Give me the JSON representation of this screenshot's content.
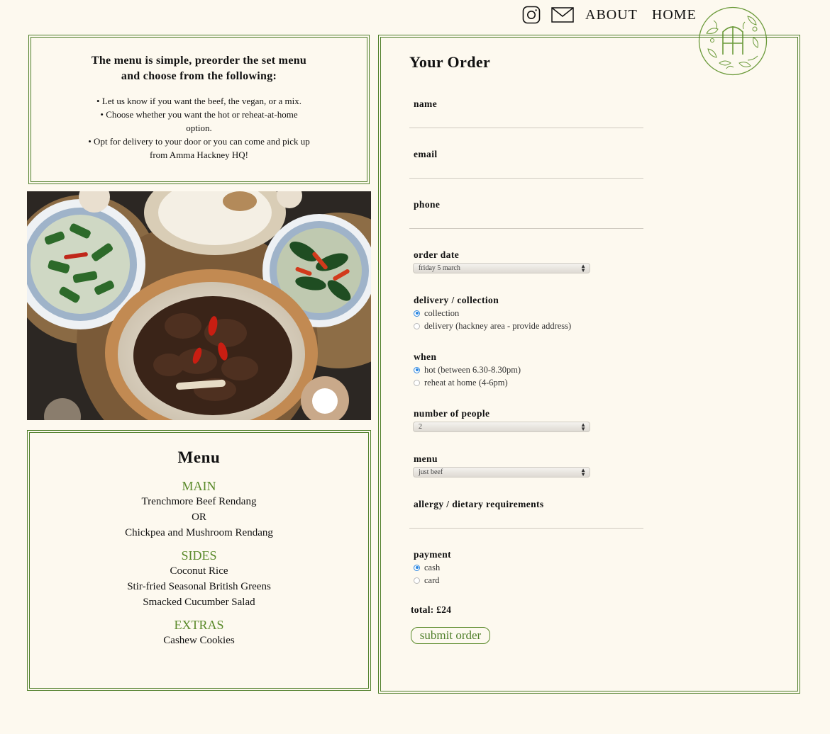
{
  "nav": {
    "about": "ABOUT",
    "home": "HOME",
    "icons": [
      "instagram-icon",
      "mail-icon"
    ]
  },
  "intro": {
    "heading_line1": "The menu is simple, preorder the set menu",
    "heading_line2": "and choose from the following:",
    "bullets": [
      "• Let us know if you want the beef, the vegan, or a mix.",
      "• Choose whether you want the hot or reheat-at-home",
      "option.",
      "• Opt for delivery to your door or you can come and pick up",
      "from Amma Hackney HQ!"
    ]
  },
  "menu": {
    "title": "Menu",
    "main_label": "MAIN",
    "main_items": [
      "Trenchmore Beef Rendang",
      "OR",
      "Chickpea and Mushroom Rendang"
    ],
    "sides_label": "SIDES",
    "sides_items": [
      "Coconut Rice",
      "Stir-fried Seasonal British Greens",
      "Smacked Cucumber Salad"
    ],
    "extras_label": "EXTRAS",
    "extras_items": [
      "Cashew Cookies"
    ]
  },
  "order": {
    "title": "Your Order",
    "name_label": "name",
    "email_label": "email",
    "phone_label": "phone",
    "order_date_label": "order date",
    "order_date_value": "friday 5 march",
    "delivery_label": "delivery / collection",
    "delivery_options": [
      "collection",
      "delivery (hackney area - provide address)"
    ],
    "when_label": "when",
    "when_options": [
      "hot (between 6.30-8.30pm)",
      "reheat at home (4-6pm)"
    ],
    "people_label": "number of people",
    "people_value": "2",
    "menu_label": "menu",
    "menu_value": "just beef",
    "allergy_label": "allergy / dietary requirements",
    "payment_label": "payment",
    "payment_options": [
      "cash",
      "card"
    ],
    "total": "total: £24",
    "submit": "submit order"
  },
  "colors": {
    "background": "#fdf9ef",
    "accent_green": "#5a8a2a",
    "radio_blue": "#2b86e0"
  }
}
